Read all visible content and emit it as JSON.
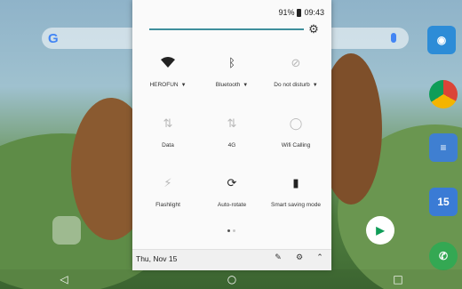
{
  "status_bar": {
    "battery": "91%",
    "time": "09:43"
  },
  "quick_settings": {
    "row1": [
      {
        "label": "HEROFUN",
        "icon": "wifi-icon",
        "has_dropdown": true
      },
      {
        "label": "Bluetooth",
        "icon": "bluetooth-icon",
        "has_dropdown": true
      },
      {
        "label": "Do not disturb",
        "icon": "do-not-disturb-icon",
        "has_dropdown": true
      }
    ],
    "row2": [
      {
        "label": "Data",
        "icon": "data-off-icon"
      },
      {
        "label": "4G",
        "icon": "4g-off-icon"
      },
      {
        "label": "Wifi Calling",
        "icon": "wifi-calling-icon"
      }
    ],
    "row3": [
      {
        "label": "Flashlight",
        "icon": "flashlight-off-icon"
      },
      {
        "label": "Auto-rotate",
        "icon": "auto-rotate-icon"
      },
      {
        "label": "Smart saving mode",
        "icon": "battery-saver-icon"
      }
    ],
    "page_indicator": {
      "current": 1,
      "total": 2
    }
  },
  "footer": {
    "date": "Thu, Nov 15"
  },
  "colors": {
    "accent": "#3f8f9c",
    "panel_bg": "#fafafa"
  }
}
